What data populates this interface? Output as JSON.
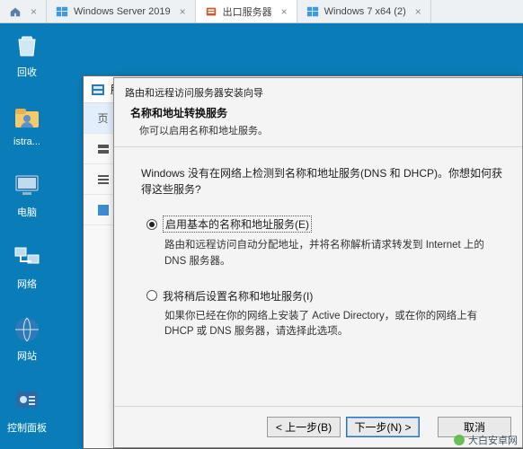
{
  "tabs": [
    {
      "label": "",
      "icon": "home"
    },
    {
      "label": "Windows Server 2019",
      "icon": "win"
    },
    {
      "label": "出口服务器",
      "icon": "chip",
      "active": true
    },
    {
      "label": "Windows 7 x64 (2)",
      "icon": "win"
    }
  ],
  "desktop": {
    "recycle": "回收",
    "admin_suffix": "istra...",
    "thispc": "电脑",
    "network": "网络",
    "sites": "网站",
    "panel": "控制面板"
  },
  "behind": {
    "title": "服务器",
    "side_char": "页"
  },
  "wizard": {
    "window_title": "路由和远程访问服务器安装向导",
    "heading": "名称和地址转换服务",
    "subheading": "你可以启用名称和地址服务。",
    "lead": "Windows 没有在网络上检测到名称和地址服务(DNS 和 DHCP)。你想如何获得这些服务?",
    "options": [
      {
        "selected": true,
        "label": "启用基本的名称和地址服务(E)",
        "desc": "路由和远程访问自动分配地址，并将名称解析请求转发到 Internet 上的 DNS 服务器。"
      },
      {
        "selected": false,
        "label": "我将稍后设置名称和地址服务(I)",
        "desc": "如果你已经在你的网络上安装了 Active Directory，或在你的网络上有 DHCP 或 DNS 服务器，请选择此选项。"
      }
    ],
    "buttons": {
      "back": "< 上一步(B)",
      "next": "下一步(N) >",
      "cancel": "取消"
    }
  },
  "watermark": "大白安卓网"
}
